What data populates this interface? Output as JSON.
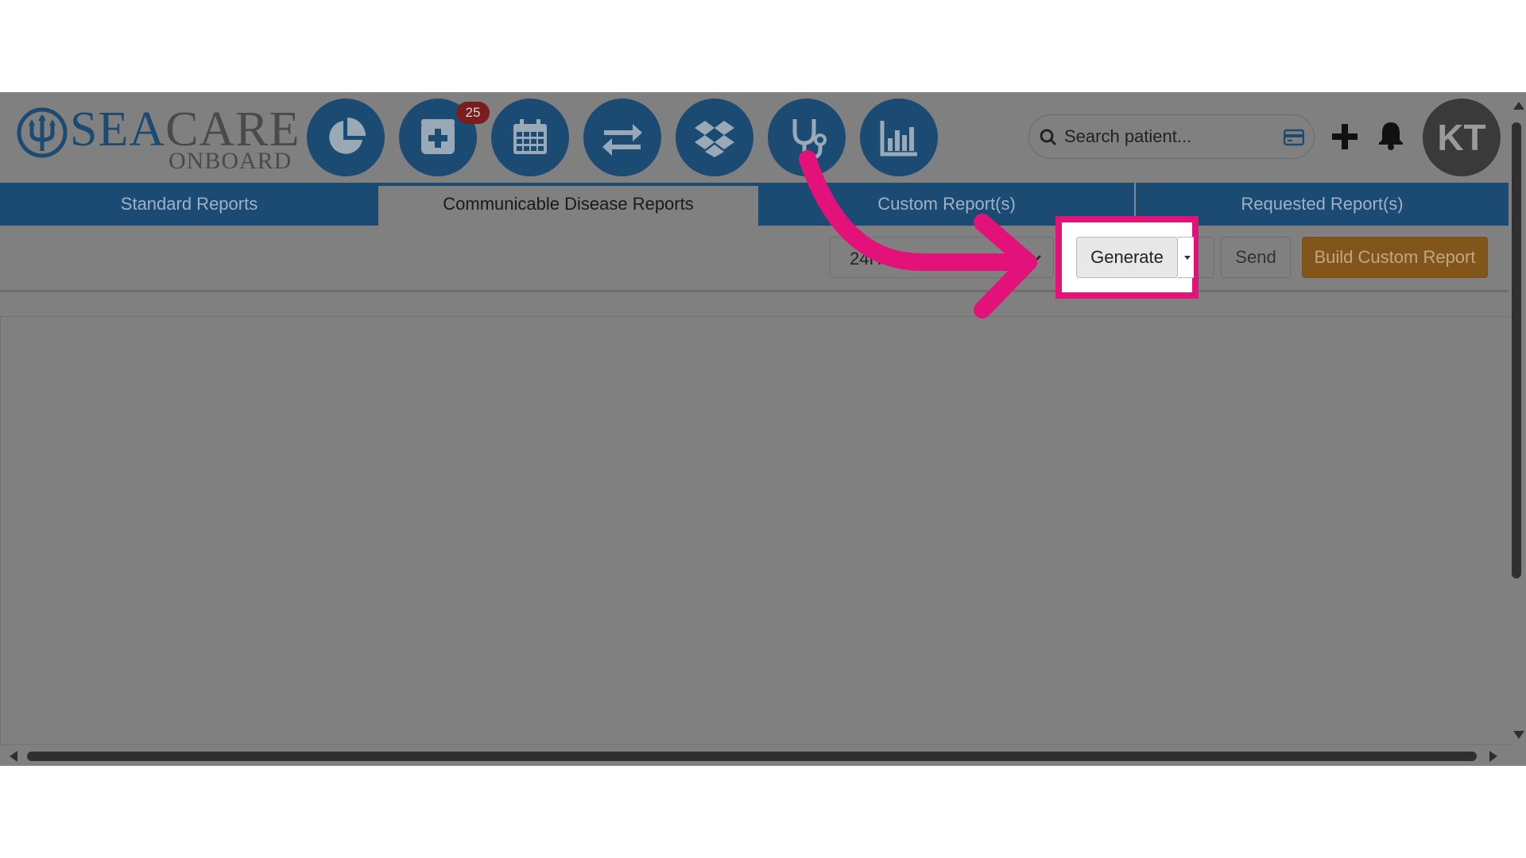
{
  "app": {
    "brand_sea": "SEA",
    "brand_care": "CARE",
    "brand_sub": "ONBOARD"
  },
  "nav": {
    "items": [
      {
        "name": "dashboard",
        "icon": "pie-chart-icon"
      },
      {
        "name": "medical",
        "icon": "medical-plus-icon",
        "badge": "25"
      },
      {
        "name": "calendar",
        "icon": "calendar-icon"
      },
      {
        "name": "transfers",
        "icon": "exchange-arrows-icon"
      },
      {
        "name": "dropbox",
        "icon": "dropbox-icon"
      },
      {
        "name": "clinical",
        "icon": "stethoscope-icon"
      },
      {
        "name": "reports",
        "icon": "bar-chart-icon"
      }
    ]
  },
  "search": {
    "placeholder": "Search patient..."
  },
  "user": {
    "initials": "KT"
  },
  "tabs": [
    {
      "label": "Standard Reports",
      "active": false
    },
    {
      "label": "Communicable Disease Reports",
      "active": true
    },
    {
      "label": "Custom Report(s)",
      "active": false
    },
    {
      "label": "Requested Report(s)",
      "active": false
    }
  ],
  "toolbar": {
    "period_value": "24H",
    "generate_label": "Generate",
    "send_label": "Send",
    "build_label": "Build Custom Report"
  },
  "colors": {
    "brand_blue": "#1b4a72",
    "highlight_pink": "#e3127a",
    "build_button": "#82561a",
    "overlay_gray": "#808080"
  }
}
